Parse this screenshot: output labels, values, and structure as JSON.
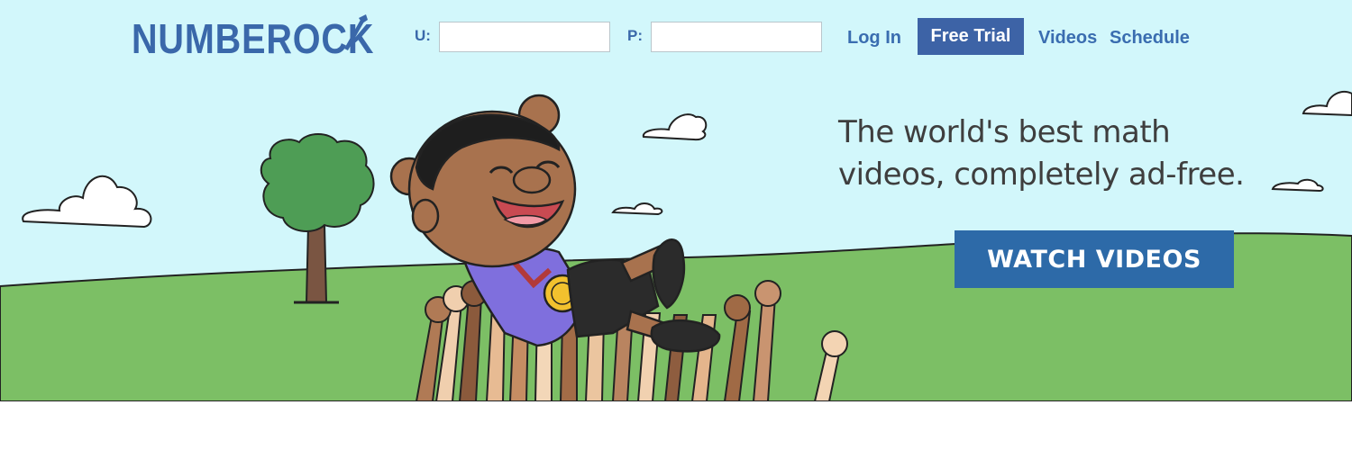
{
  "header": {
    "logo_text": "NUMBEROCK",
    "username_label": "U:",
    "username_value": "",
    "password_label": "P:",
    "password_value": "",
    "nav": {
      "login": "Log In",
      "free_trial": "Free Trial",
      "videos": "Videos",
      "schedule": "Schedule"
    }
  },
  "hero": {
    "tagline_line1": "The world's best math",
    "tagline_line2": "videos, completely ad-free.",
    "cta": "WATCH VIDEOS"
  },
  "colors": {
    "brand_blue": "#3a68aa",
    "free_trial_bg": "#3d63a6",
    "cta_bg": "#2d6aa8",
    "sky": "#d2f7fb",
    "grass": "#7cbf65",
    "tagline_text": "#3e3e3e"
  }
}
